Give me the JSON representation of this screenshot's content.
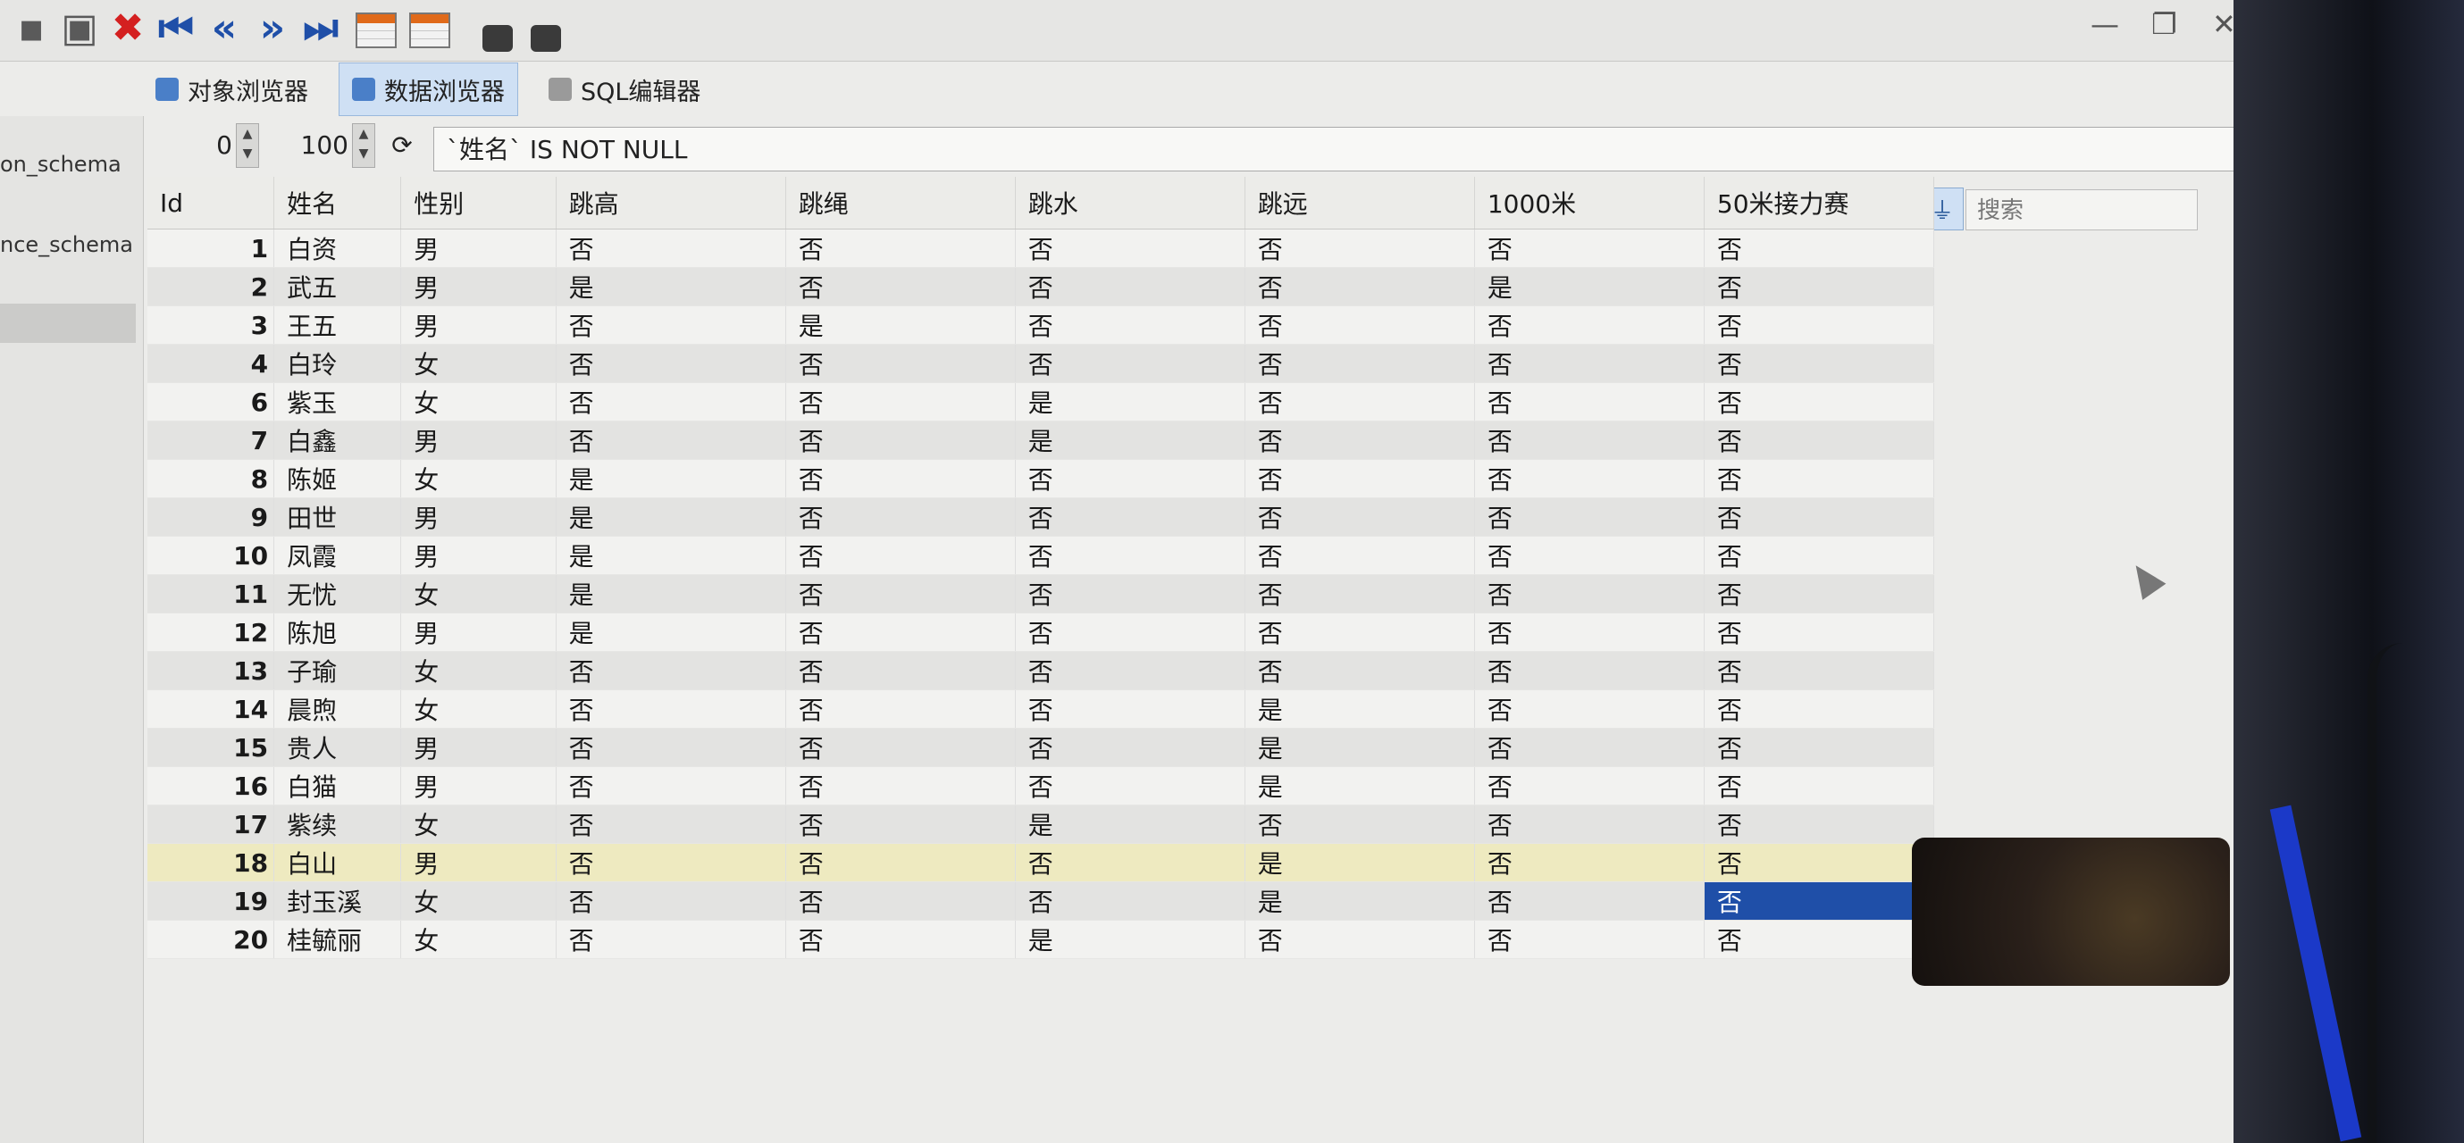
{
  "tabs": [
    {
      "label": "对象浏览器",
      "icon": "object-browser-icon"
    },
    {
      "label": "数据浏览器",
      "icon": "data-browser-icon"
    },
    {
      "label": "SQL编辑器",
      "icon": "sql-editor-icon"
    }
  ],
  "nav": {
    "items": [
      "on_schema",
      "nce_schema"
    ]
  },
  "filter": {
    "offset": "0",
    "limit": "100",
    "expression": "`姓名` IS NOT NULL",
    "search_placeholder": "搜索"
  },
  "grid": {
    "columns": [
      "Id",
      "姓名",
      "性别",
      "跳高",
      "跳绳",
      "跳水",
      "跳远",
      "1000米",
      "50米接力赛"
    ],
    "rows": [
      [
        "1",
        "白资",
        "男",
        "否",
        "否",
        "否",
        "否",
        "否",
        "否"
      ],
      [
        "2",
        "武五",
        "男",
        "是",
        "否",
        "否",
        "否",
        "是",
        "否"
      ],
      [
        "3",
        "王五",
        "男",
        "否",
        "是",
        "否",
        "否",
        "否",
        "否"
      ],
      [
        "4",
        "白玲",
        "女",
        "否",
        "否",
        "否",
        "否",
        "否",
        "否"
      ],
      [
        "6",
        "紫玉",
        "女",
        "否",
        "否",
        "是",
        "否",
        "否",
        "否"
      ],
      [
        "7",
        "白鑫",
        "男",
        "否",
        "否",
        "是",
        "否",
        "否",
        "否"
      ],
      [
        "8",
        "陈姬",
        "女",
        "是",
        "否",
        "否",
        "否",
        "否",
        "否"
      ],
      [
        "9",
        "田世",
        "男",
        "是",
        "否",
        "否",
        "否",
        "否",
        "否"
      ],
      [
        "10",
        "凤霞",
        "男",
        "是",
        "否",
        "否",
        "否",
        "否",
        "否"
      ],
      [
        "11",
        "无忧",
        "女",
        "是",
        "否",
        "否",
        "否",
        "否",
        "否"
      ],
      [
        "12",
        "陈旭",
        "男",
        "是",
        "否",
        "否",
        "否",
        "否",
        "否"
      ],
      [
        "13",
        "子瑜",
        "女",
        "否",
        "否",
        "否",
        "否",
        "否",
        "否"
      ],
      [
        "14",
        "晨煦",
        "女",
        "否",
        "否",
        "否",
        "是",
        "否",
        "否"
      ],
      [
        "15",
        "贵人",
        "男",
        "否",
        "否",
        "否",
        "是",
        "否",
        "否"
      ],
      [
        "16",
        "白猫",
        "男",
        "否",
        "否",
        "否",
        "是",
        "否",
        "否"
      ],
      [
        "17",
        "紫续",
        "女",
        "否",
        "否",
        "是",
        "否",
        "否",
        "否"
      ],
      [
        "18",
        "白山",
        "男",
        "否",
        "否",
        "否",
        "是",
        "否",
        "否"
      ],
      [
        "19",
        "封玉溪",
        "女",
        "否",
        "否",
        "否",
        "是",
        "否",
        "否"
      ],
      [
        "20",
        "桂毓丽",
        "女",
        "否",
        "否",
        "是",
        "否",
        "否",
        "否"
      ]
    ],
    "highlighted_row_index": 16,
    "selected_cell": {
      "row_index": 17,
      "column": "50米接力赛"
    }
  },
  "colors": {
    "accent": "#1f4fa8",
    "highlight_row": "#eeeac0",
    "row_alt": "#e3e3e1"
  }
}
